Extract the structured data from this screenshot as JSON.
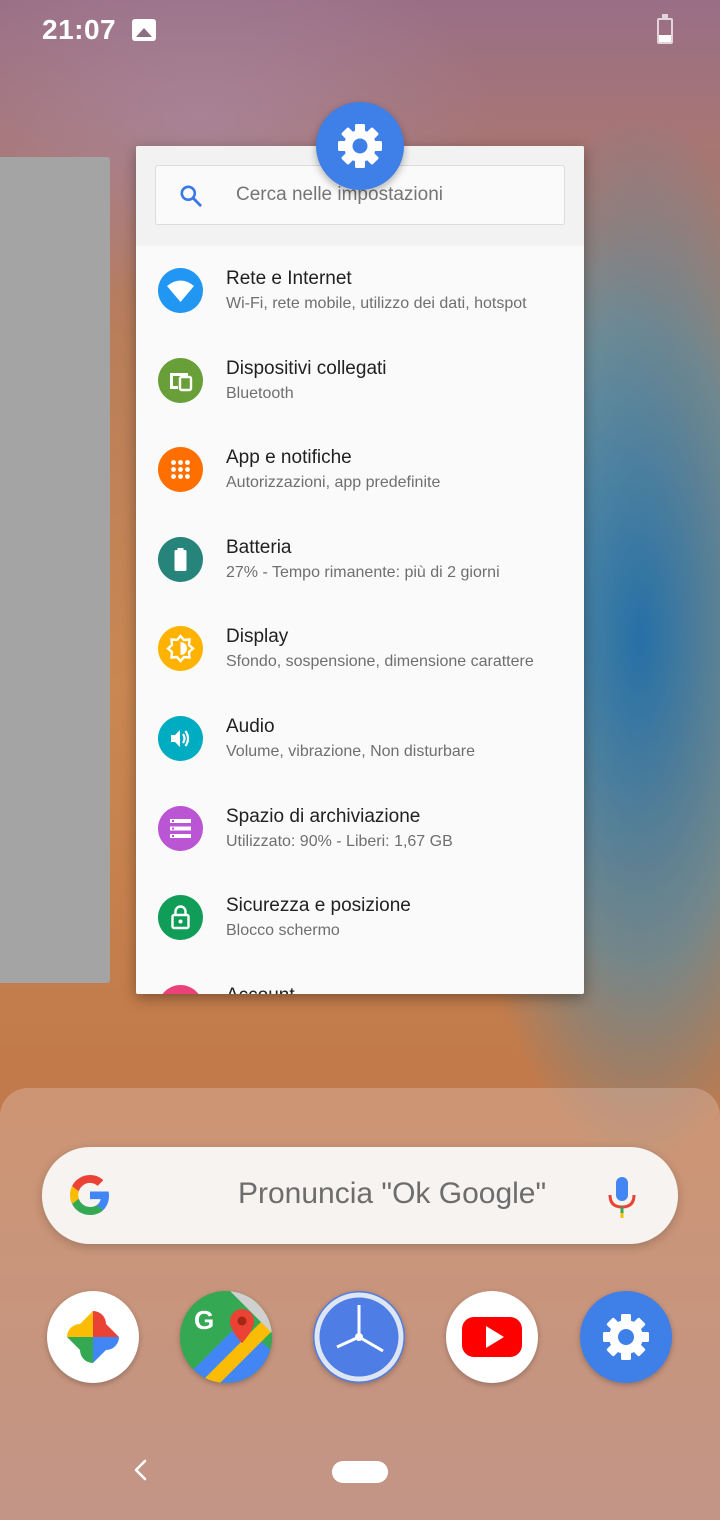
{
  "status_bar": {
    "time": "21:07",
    "battery_level": 0.3
  },
  "settings_card": {
    "search_placeholder": "Cerca nelle impostazioni",
    "items": [
      {
        "title": "Rete e Internet",
        "subtitle": "Wi-Fi, rete mobile, utilizzo dei dati, hotspot",
        "icon": "wifi-icon",
        "color": "#2196f3"
      },
      {
        "title": "Dispositivi collegati",
        "subtitle": "Bluetooth",
        "icon": "devices-icon",
        "color": "#689f38"
      },
      {
        "title": "App e notifiche",
        "subtitle": "Autorizzazioni, app predefinite",
        "icon": "apps-icon",
        "color": "#ff6f00"
      },
      {
        "title": "Batteria",
        "subtitle": "27% - Tempo rimanente: più di 2 giorni",
        "icon": "battery-icon",
        "color": "#26847b"
      },
      {
        "title": "Display",
        "subtitle": "Sfondo, sospensione, dimensione carattere",
        "icon": "brightness-icon",
        "color": "#ffb300"
      },
      {
        "title": "Audio",
        "subtitle": "Volume, vibrazione, Non disturbare",
        "icon": "volume-icon",
        "color": "#00acc1"
      },
      {
        "title": "Spazio di archiviazione",
        "subtitle": "Utilizzato: 90% - Liberi: 1,67 GB",
        "icon": "storage-icon",
        "color": "#ba55d3"
      },
      {
        "title": "Sicurezza e posizione",
        "subtitle": "Blocco schermo",
        "icon": "lock-icon",
        "color": "#0f9d58"
      },
      {
        "title": "Account",
        "subtitle": "",
        "icon": "account-icon",
        "color": "#ec407a"
      }
    ]
  },
  "google_search": {
    "placeholder": "Pronuncia \"Ok Google\""
  },
  "dock_apps": [
    {
      "name": "Foto",
      "icon": "google-photos-icon"
    },
    {
      "name": "Maps",
      "icon": "google-maps-icon"
    },
    {
      "name": "Orologio",
      "icon": "clock-icon"
    },
    {
      "name": "YouTube",
      "icon": "youtube-icon"
    },
    {
      "name": "Impostazioni",
      "icon": "settings-icon"
    }
  ]
}
